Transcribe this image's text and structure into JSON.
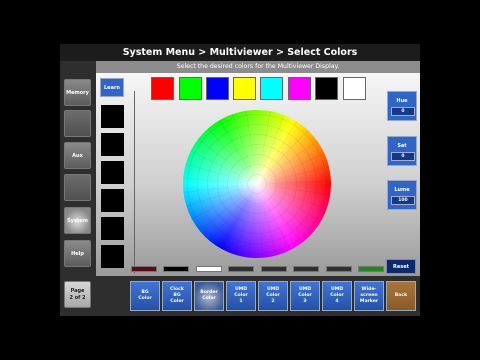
{
  "title": "System Menu > Multiviewer > Select Colors",
  "subtitle": "Select the desired colors for the Multiviewer Display.",
  "left_nav": {
    "memory": "Memory",
    "aux": "Aux",
    "system": "System",
    "help": "Help",
    "page_line1": "Page",
    "page_line2": "2 of 2"
  },
  "learn": "Learn",
  "top_swatches": [
    "#ff0000",
    "#00ff00",
    "#0000ff",
    "#ffff00",
    "#00ffff",
    "#ff00ff",
    "#000000",
    "#ffffff"
  ],
  "bottom_swatches": [
    "#5a0a14",
    "#000000",
    "#ffffff",
    "#303030",
    "#303030",
    "#303030",
    "#303030",
    "#1a8a1a"
  ],
  "reset": "Reset",
  "hue": {
    "label": "Hue",
    "value": "0"
  },
  "sat": {
    "label": "Sat",
    "value": "0"
  },
  "lume": {
    "label": "Lume",
    "value": "100"
  },
  "bottom_buttons": [
    {
      "l1": "BG",
      "l2": "Color",
      "l3": "",
      "l4": ""
    },
    {
      "l1": "Clock",
      "l2": "BG",
      "l3": "Color",
      "l4": ""
    },
    {
      "l1": "Border",
      "l2": "Color",
      "l3": "",
      "l4": ""
    },
    {
      "l1": "UMD",
      "l2": "Color",
      "l3": "1",
      "l4": ""
    },
    {
      "l1": "UMD",
      "l2": "Color",
      "l3": "2",
      "l4": ""
    },
    {
      "l1": "UMD",
      "l2": "Color",
      "l3": "3",
      "l4": ""
    },
    {
      "l1": "UMD",
      "l2": "Color",
      "l3": "4",
      "l4": ""
    },
    {
      "l1": "Wide-",
      "l2": "screen",
      "l3": "Marker",
      "l4": ""
    }
  ],
  "back": "Back"
}
